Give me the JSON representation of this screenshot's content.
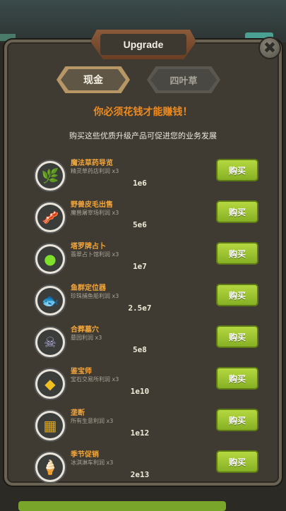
{
  "window": {
    "title": "Upgrade",
    "close_symbol": "✖"
  },
  "tabs": [
    {
      "label": "现金",
      "active": true
    },
    {
      "label": "四叶草",
      "active": false
    }
  ],
  "headline": "你必须花钱才能赚钱！",
  "subline": "购买这些优质升级产品可促进您的业务发展",
  "upgrades": [
    {
      "name": "魔法草药导览",
      "desc": "精灵草药店利润 x3",
      "cost": "1e6",
      "buy": "购买",
      "icon": "herb-icon",
      "glyph": "🌿",
      "icon_color": "#2e5cc0"
    },
    {
      "name": "野兽皮毛出售",
      "desc": "魔兽屠宰场利润 x3",
      "cost": "5e6",
      "buy": "购买",
      "icon": "fur-icon",
      "glyph": "🥓",
      "icon_color": "#b22a2a"
    },
    {
      "name": "塔罗牌占卜",
      "desc": "翡翠占卜馆利润 x3",
      "cost": "1e7",
      "buy": "购买",
      "icon": "crystal-eye-icon",
      "glyph": "●",
      "icon_color": "#7ee02a"
    },
    {
      "name": "鱼群定位器",
      "desc": "珍珠捕鱼船利润 x3",
      "cost": "2.5e7",
      "buy": "购买",
      "icon": "fish-icon",
      "glyph": "🐟",
      "icon_color": "#d8c88a"
    },
    {
      "name": "合葬墓穴",
      "desc": "墓园利润 x3",
      "cost": "5e8",
      "buy": "购买",
      "icon": "skull-icon",
      "glyph": "☠",
      "icon_color": "#b0a8d8"
    },
    {
      "name": "鉴宝师",
      "desc": "宝石交易所利润 x3",
      "cost": "1e10",
      "buy": "购买",
      "icon": "gem-icon",
      "glyph": "◆",
      "icon_color": "#f0c020"
    },
    {
      "name": "垄断",
      "desc": "所有生意利润 x3",
      "cost": "1e12",
      "buy": "购买",
      "icon": "gold-pile-icon",
      "glyph": "▦",
      "icon_color": "#e0a820"
    },
    {
      "name": "季节促销",
      "desc": "冰淇淋车利润 x3",
      "cost": "2e13",
      "buy": "购买",
      "icon": "ice-cream-icon",
      "glyph": "🍦",
      "icon_color": "#9ed8f0"
    }
  ]
}
